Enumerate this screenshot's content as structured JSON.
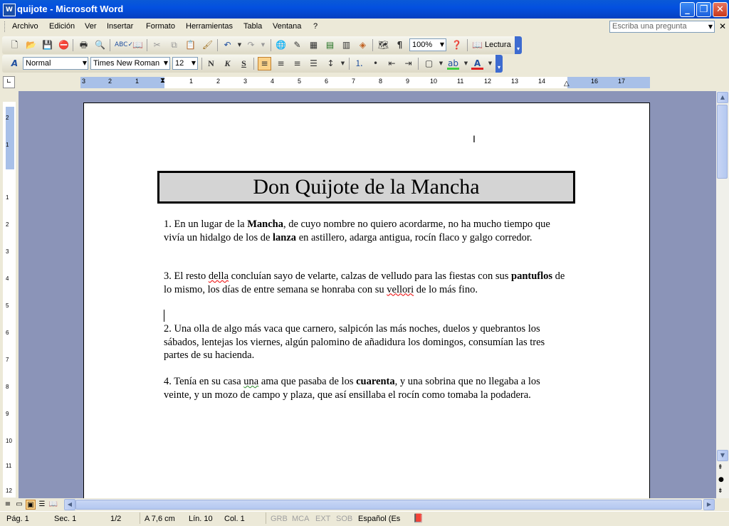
{
  "window": {
    "title": "quijote - Microsoft Word",
    "app_icon": "W"
  },
  "menu": {
    "items": [
      "Archivo",
      "Edición",
      "Ver",
      "Insertar",
      "Formato",
      "Herramientas",
      "Tabla",
      "Ventana",
      "?"
    ],
    "ask_placeholder": "Escriba una pregunta"
  },
  "standard_toolbar": {
    "zoom": "100%",
    "reading_label": "Lectura"
  },
  "format_toolbar": {
    "style": "Normal",
    "font": "Times New Roman",
    "size": "12",
    "bold": "N",
    "italic": "K",
    "underline": "S"
  },
  "ruler": {
    "labels": [
      "3",
      "2",
      "1",
      "1",
      "2",
      "3",
      "4",
      "5",
      "6",
      "7",
      "8",
      "9",
      "10",
      "11",
      "12",
      "13",
      "14",
      "16",
      "17"
    ]
  },
  "vertical_ruler": {
    "labels": [
      "2",
      "1",
      "1",
      "2",
      "3",
      "4",
      "5",
      "6",
      "7",
      "8",
      "9",
      "10",
      "11",
      "12"
    ]
  },
  "document": {
    "title": "Don Quijote de la Mancha",
    "paragraphs": [
      {
        "p1a": "1. En un lugar de la ",
        "p1b": "Mancha",
        "p1c": ", de cuyo nombre no quiero acordarme, no ha mucho tiempo que vivía un hidalgo de los de ",
        "p1d": "lanza",
        "p1e": " en astillero, adarga antigua, rocín flaco y galgo corredor."
      },
      {
        "p3a": "3. El resto ",
        "p3b": "della",
        "p3c": " concluían sayo de velarte, calzas de velludo para las fiestas con sus ",
        "p3d": "pantuflos",
        "p3e": " de lo mismo, los días de entre semana se honraba con su ",
        "p3f": "vellori",
        "p3g": " de lo más fino."
      },
      {
        "p2": "2. Una olla de algo más vaca que carnero, salpicón las más noches, duelos y quebrantos los sábados, lentejas los viernes, algún palomino de añadidura los domingos, consumían las tres partes de su hacienda."
      },
      {
        "p4a": "4. Tenía en su casa ",
        "p4b": "una",
        "p4c": " ama que pasaba de los ",
        "p4d": "cuarenta",
        "p4e": ", y una sobrina que no llegaba a los veinte, y un mozo de campo y plaza, que así ensillaba el rocín como tomaba la podadera."
      }
    ]
  },
  "status": {
    "page": "Pág. 1",
    "section": "Sec. 1",
    "pages": "1/2",
    "at": "A 7,6 cm",
    "line": "Lín. 10",
    "col": "Col. 1",
    "grb": "GRB",
    "mca": "MCA",
    "ext": "EXT",
    "sob": "SOB",
    "language": "Español (Es"
  },
  "colors": {
    "titlebar": "#0350e0",
    "page": "#ffffff",
    "doc_bg": "#8b94b8",
    "ruler_margin": "#a8c0e8"
  }
}
